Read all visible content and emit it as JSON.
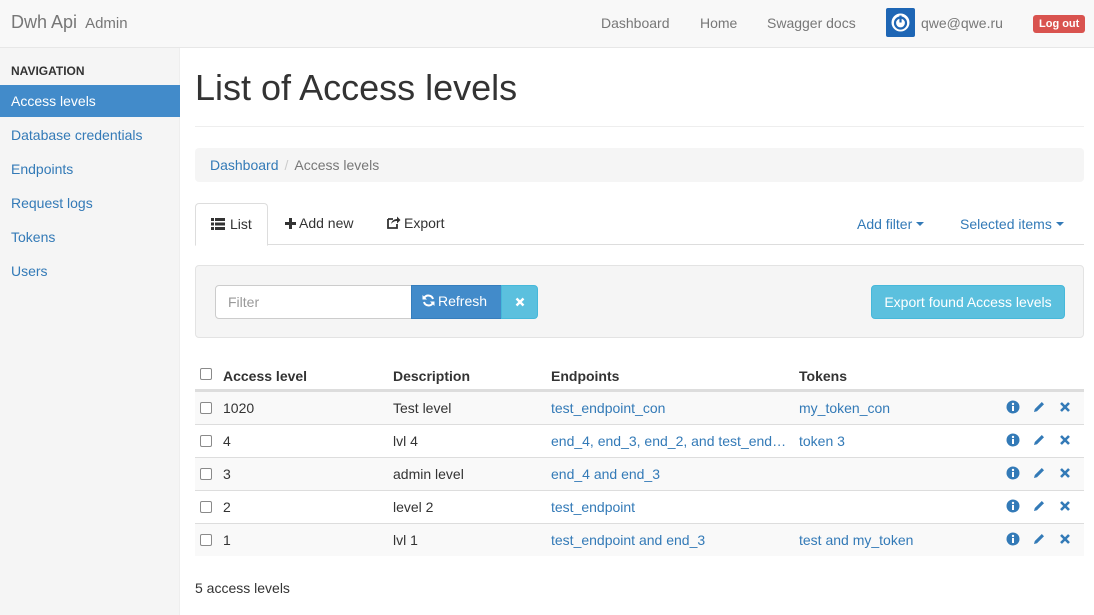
{
  "brand": {
    "title": "Dwh Api",
    "subtitle": "Admin"
  },
  "topnav": {
    "links": [
      "Dashboard",
      "Home",
      "Swagger docs"
    ],
    "user_email": "qwe@qwe.ru",
    "logout_label": "Log out"
  },
  "sidebar": {
    "header": "Navigation",
    "items": [
      {
        "label": "Access levels",
        "active": true
      },
      {
        "label": "Database credentials"
      },
      {
        "label": "Endpoints"
      },
      {
        "label": "Request logs"
      },
      {
        "label": "Tokens"
      },
      {
        "label": "Users"
      }
    ]
  },
  "page": {
    "title": "List of Access levels",
    "breadcrumb": [
      "Dashboard",
      "Access levels"
    ]
  },
  "tabs": {
    "list": "List",
    "add_new": "Add new",
    "export": "Export",
    "add_filter": "Add filter",
    "selected_items": "Selected items"
  },
  "filter": {
    "placeholder": "Filter",
    "refresh_label": "Refresh",
    "export_found_label": "Export found Access levels"
  },
  "table": {
    "columns": [
      "Access level",
      "Description",
      "Endpoints",
      "Tokens"
    ],
    "rows": [
      {
        "level": "1020",
        "description": "Test level",
        "endpoints": "test_endpoint_con",
        "tokens": "my_token_con"
      },
      {
        "level": "4",
        "description": "lvl 4",
        "endpoints": "end_4, end_3, end_2, and test_end…",
        "tokens": "token 3"
      },
      {
        "level": "3",
        "description": "admin level",
        "endpoints": "end_4 and end_3",
        "tokens": ""
      },
      {
        "level": "2",
        "description": "level 2",
        "endpoints": "test_endpoint",
        "tokens": ""
      },
      {
        "level": "1",
        "description": "lvl 1",
        "endpoints": "test_endpoint and end_3",
        "tokens": "test and my_token"
      }
    ]
  },
  "footer": {
    "count": "5 access levels"
  },
  "colors": {
    "primary": "#428bca",
    "info": "#5bc0de",
    "danger": "#d9534f",
    "link": "#337ab7"
  }
}
